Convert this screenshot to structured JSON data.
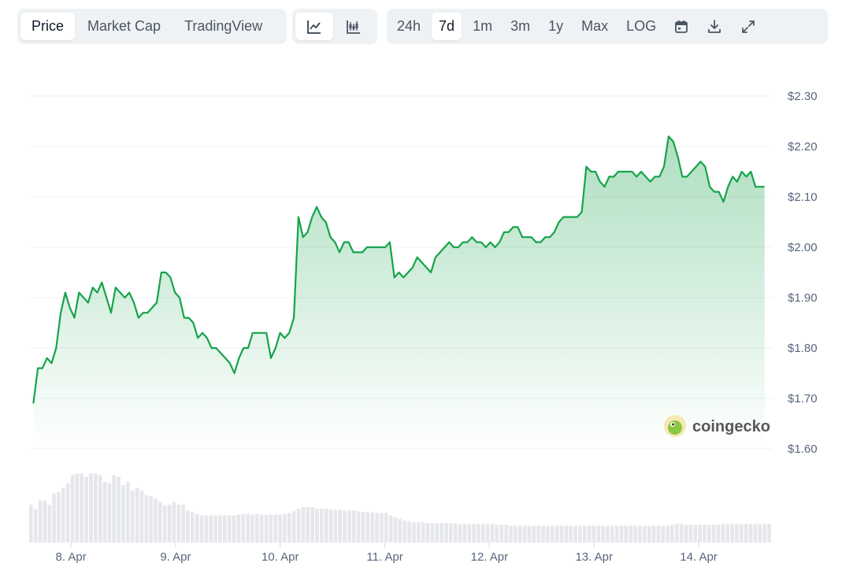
{
  "toolbar": {
    "view_tabs": [
      "Price",
      "Market Cap",
      "TradingView"
    ],
    "active_view": "Price",
    "chart_type_icons": [
      "line-chart-icon",
      "candlestick-chart-icon"
    ],
    "active_chart_type": "line-chart-icon",
    "ranges": [
      "24h",
      "7d",
      "1m",
      "3m",
      "1y",
      "Max",
      "LOG"
    ],
    "active_range": "7d",
    "tool_icons": [
      "calendar-icon",
      "download-icon",
      "fullscreen-icon"
    ]
  },
  "watermark": {
    "text": "coingecko"
  },
  "colors": {
    "line": "#16a34a",
    "fill_top": "#16a34a",
    "volume": "#e5e7eb",
    "grid": "#eef0f3"
  },
  "chart_data": {
    "type": "area",
    "title": "",
    "xlabel": "",
    "ylabel": "",
    "ylim": [
      1.6,
      2.3
    ],
    "y_ticks": [
      1.6,
      1.7,
      1.8,
      1.9,
      2.0,
      2.1,
      2.2,
      2.3
    ],
    "y_tick_labels": [
      "$1.60",
      "$1.70",
      "$1.80",
      "$1.90",
      "$2.00",
      "$2.10",
      "$2.20",
      "$2.30"
    ],
    "y_axis_side": "right",
    "x_range_days": [
      7.6,
      14.7
    ],
    "x_ticks": [
      8,
      9,
      10,
      11,
      12,
      13,
      14
    ],
    "x_tick_labels": [
      "8. Apr",
      "9. Apr",
      "10. Apr",
      "11. Apr",
      "12. Apr",
      "13. Apr",
      "14. Apr"
    ],
    "grid": true,
    "legend": "none",
    "series": [
      {
        "x_start_day": 7.64,
        "x_end_day": 14.63,
        "values": [
          1.69,
          1.76,
          1.76,
          1.78,
          1.77,
          1.8,
          1.87,
          1.91,
          1.88,
          1.86,
          1.91,
          1.9,
          1.89,
          1.92,
          1.91,
          1.93,
          1.9,
          1.87,
          1.92,
          1.91,
          1.9,
          1.91,
          1.89,
          1.86,
          1.87,
          1.87,
          1.88,
          1.89,
          1.95,
          1.95,
          1.94,
          1.91,
          1.9,
          1.86,
          1.86,
          1.85,
          1.82,
          1.83,
          1.82,
          1.8,
          1.8,
          1.79,
          1.78,
          1.77,
          1.75,
          1.78,
          1.8,
          1.8,
          1.83,
          1.83,
          1.83,
          1.83,
          1.78,
          1.8,
          1.83,
          1.82,
          1.83,
          1.86,
          2.06,
          2.02,
          2.03,
          2.06,
          2.08,
          2.06,
          2.05,
          2.02,
          2.01,
          1.99,
          2.01,
          2.01,
          1.99,
          1.99,
          1.99,
          2.0,
          2.0,
          2.0,
          2.0,
          2.0,
          2.01,
          1.94,
          1.95,
          1.94,
          1.95,
          1.96,
          1.98,
          1.97,
          1.96,
          1.95,
          1.98,
          1.99,
          2.0,
          2.01,
          2.0,
          2.0,
          2.01,
          2.01,
          2.02,
          2.01,
          2.01,
          2.0,
          2.01,
          2.0,
          2.01,
          2.03,
          2.03,
          2.04,
          2.04,
          2.02,
          2.02,
          2.02,
          2.01,
          2.01,
          2.02,
          2.02,
          2.03,
          2.05,
          2.06,
          2.06,
          2.06,
          2.06,
          2.07,
          2.16,
          2.15,
          2.15,
          2.13,
          2.12,
          2.14,
          2.14,
          2.15,
          2.15,
          2.15,
          2.15,
          2.14,
          2.15,
          2.14,
          2.13,
          2.14,
          2.14,
          2.16,
          2.22,
          2.21,
          2.18,
          2.14,
          2.14,
          2.15,
          2.16,
          2.17,
          2.16,
          2.12,
          2.11,
          2.11,
          2.09,
          2.12,
          2.14,
          2.13,
          2.15,
          2.14,
          2.15,
          2.12,
          2.12,
          2.12
        ]
      }
    ],
    "volume": {
      "type": "bar",
      "values_relative": [
        0.45,
        0.4,
        0.5,
        0.5,
        0.45,
        0.58,
        0.6,
        0.65,
        0.7,
        0.8,
        0.82,
        0.82,
        0.78,
        0.82,
        0.82,
        0.8,
        0.72,
        0.7,
        0.8,
        0.78,
        0.68,
        0.72,
        0.62,
        0.65,
        0.62,
        0.56,
        0.55,
        0.52,
        0.48,
        0.44,
        0.45,
        0.48,
        0.45,
        0.45,
        0.38,
        0.36,
        0.34,
        0.32,
        0.32,
        0.32,
        0.32,
        0.32,
        0.32,
        0.32,
        0.32,
        0.33,
        0.34,
        0.34,
        0.33,
        0.34,
        0.33,
        0.33,
        0.33,
        0.33,
        0.33,
        0.34,
        0.35,
        0.37,
        0.4,
        0.42,
        0.42,
        0.42,
        0.4,
        0.4,
        0.4,
        0.39,
        0.39,
        0.39,
        0.38,
        0.38,
        0.38,
        0.37,
        0.36,
        0.36,
        0.36,
        0.35,
        0.35,
        0.35,
        0.32,
        0.3,
        0.28,
        0.26,
        0.25,
        0.24,
        0.24,
        0.24,
        0.23,
        0.23,
        0.23,
        0.23,
        0.23,
        0.23,
        0.23,
        0.22,
        0.22,
        0.22,
        0.22,
        0.22,
        0.22,
        0.22,
        0.22,
        0.21,
        0.21,
        0.21,
        0.2,
        0.2,
        0.2,
        0.2,
        0.2,
        0.2,
        0.2,
        0.2,
        0.2,
        0.2,
        0.2,
        0.2,
        0.2,
        0.2,
        0.2,
        0.2,
        0.2,
        0.2,
        0.2,
        0.2,
        0.2,
        0.2,
        0.2,
        0.2,
        0.2,
        0.2,
        0.2,
        0.2,
        0.2,
        0.2,
        0.2,
        0.2,
        0.2,
        0.2,
        0.2,
        0.21,
        0.22,
        0.22,
        0.21,
        0.21,
        0.21,
        0.21,
        0.21,
        0.21,
        0.21,
        0.21,
        0.22,
        0.22,
        0.22,
        0.22,
        0.22,
        0.22,
        0.22,
        0.22,
        0.22,
        0.22,
        0.22
      ]
    }
  }
}
